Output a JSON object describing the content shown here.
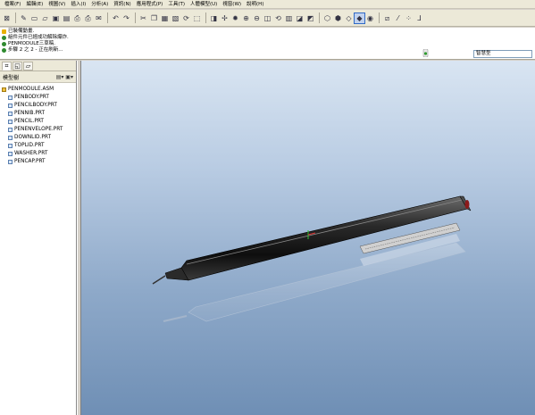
{
  "menubar": {
    "items": [
      "檔案(F)",
      "編輯(E)",
      "視圖(V)",
      "插入(I)",
      "分析(A)",
      "資訊(N)",
      "應用程式(P)",
      "工具(T)",
      "人體模型(U)",
      "視窗(W)",
      "說明(H)"
    ]
  },
  "toolbar": {
    "icons": [
      "close-window-icon",
      "pencil-icon",
      "new-file-icon",
      "open-folder-icon",
      "save-icon",
      "save-copy-icon",
      "print-icon",
      "print-setup-icon",
      "email-icon",
      "undo-icon",
      "redo-icon",
      "cut-icon",
      "copy-icon",
      "paste-icon",
      "paste-special-icon",
      "regenerate-icon",
      "select-box-icon",
      "repaint-icon",
      "spin-center-icon",
      "orient-mode-icon",
      "zoom-in-icon",
      "zoom-out-icon",
      "refit-icon",
      "reorient-icon",
      "saved-views-icon",
      "layers-icon",
      "view-manager-icon",
      "wireframe-icon",
      "hidden-line-icon",
      "no-hidden-icon",
      "shading-icon",
      "enhanced-realism-icon",
      "datum-planes-icon",
      "datum-axes-icon",
      "datum-points-icon",
      "coordinate-systems-icon"
    ]
  },
  "messages": {
    "line1": "已裝備動畫.",
    "line2": "組件元件已經成功解除爆炸.",
    "line3": "PENMODULE三草稿.",
    "line4": "步驟 2 之 2 - 正在刷新..."
  },
  "filter": {
    "value": "智慧型"
  },
  "sidepanel": {
    "tabs": [
      "model-tree-tab-icon",
      "layers-tab-icon",
      "folder-tab-icon"
    ],
    "header_label": "模型樹",
    "root": "PENMODULE.ASM",
    "parts": [
      "PENBODY.PRT",
      "PENCILBODY.PRT",
      "PENNIB.PRT",
      "PENCIL.PRT",
      "PENENVELOPE.PRT",
      "DOWNLID.PRT",
      "TOPLID.PRT",
      "WASHER.PRT",
      "PENCAP.PRT"
    ]
  },
  "colors": {
    "viewport_top": "#d9e5f2",
    "viewport_bottom": "#6f8fb5",
    "pen_body": "#1c1c1c",
    "pen_tip_accent": "#8b1a1a"
  }
}
